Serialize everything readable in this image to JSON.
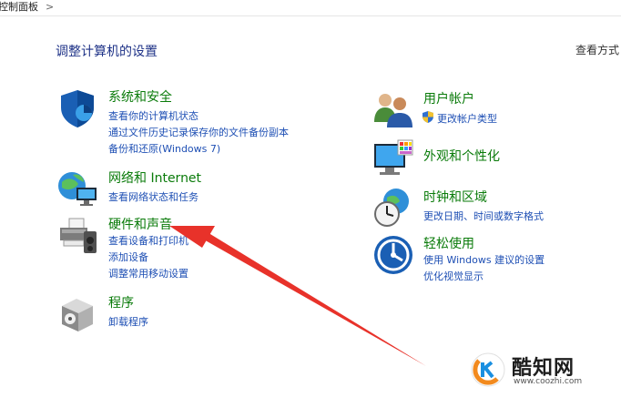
{
  "breadcrumb": "控制面板",
  "breadcrumb_chevron": ">",
  "page_title": "调整计算机的设置",
  "view_by": "查看方式",
  "left": [
    {
      "title": "系统和安全",
      "links": [
        "查看你的计算机状态",
        "通过文件历史记录保存你的文件备份副本",
        "备份和还原(Windows 7)"
      ],
      "icon": "shield-icon"
    },
    {
      "title": "网络和 Internet",
      "links": [
        "查看网络状态和任务"
      ],
      "icon": "network-globe-icon"
    },
    {
      "title": "硬件和声音",
      "links": [
        "查看设备和打印机",
        "添加设备",
        "调整常用移动设置"
      ],
      "icon": "printer-icon"
    },
    {
      "title": "程序",
      "links": [
        "卸载程序"
      ],
      "icon": "programs-box-icon"
    }
  ],
  "right": [
    {
      "title": "用户帐户",
      "links": [
        "更改帐户类型"
      ],
      "icon": "users-icon",
      "link_icon": "uac-shield-icon"
    },
    {
      "title": "外观和个性化",
      "links": [],
      "icon": "monitor-palette-icon"
    },
    {
      "title": "时钟和区域",
      "links": [
        "更改日期、时间或数字格式"
      ],
      "icon": "clock-globe-icon"
    },
    {
      "title": "轻松使用",
      "links": [
        "使用 Windows 建议的设置",
        "优化视觉显示"
      ],
      "icon": "ease-of-access-icon"
    }
  ],
  "watermark": {
    "brand": "酷知网",
    "url": "www.coozhi.com"
  },
  "colors": {
    "title_green": "#0a7b0a",
    "link_blue": "#1e4fb4",
    "arrow_red": "#e8322a",
    "heading_blue": "#1e3287"
  }
}
